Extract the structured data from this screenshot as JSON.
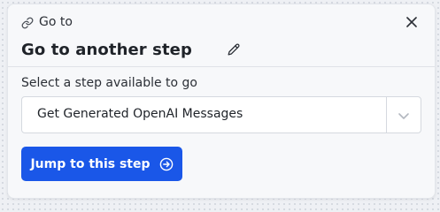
{
  "header": {
    "crumb_label": "Go to",
    "title": "Go to another step"
  },
  "step_select": {
    "label": "Select a step available to go",
    "value": "Get Generated OpenAI Messages"
  },
  "actions": {
    "jump_label": "Jump to this step"
  },
  "colors": {
    "primary": "#1a57e8",
    "panel_background": "#f7f8fa",
    "text": "#1f2329"
  },
  "icons": [
    "link-icon",
    "close-icon",
    "pencil-icon",
    "chevron-down-icon",
    "arrow-right-circle-icon"
  ]
}
